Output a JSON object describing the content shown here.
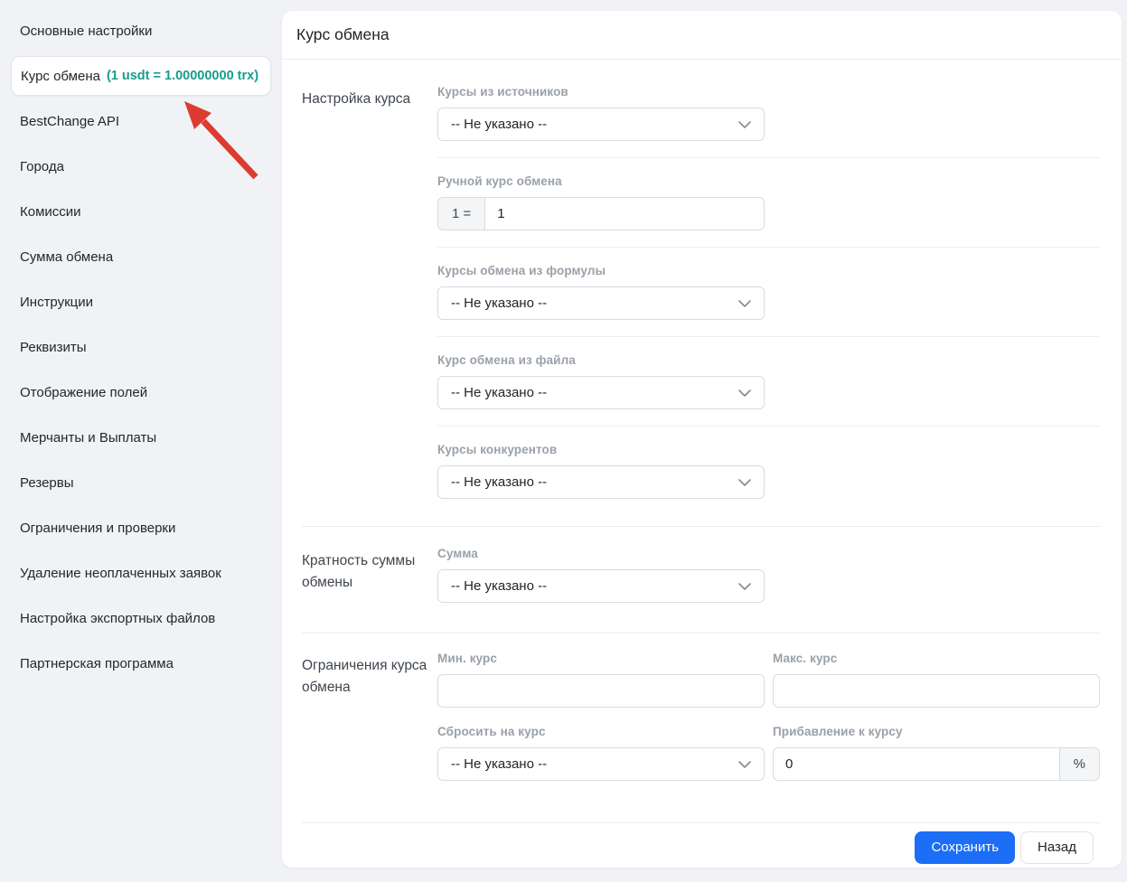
{
  "colors": {
    "page_background": "#f0f2f5",
    "accent_blue": "#1b6ef5",
    "rate_teal": "#1a9c8c",
    "annotation_red": "#dc3b2f"
  },
  "sidebar": {
    "items": [
      {
        "label": "Основные настройки"
      },
      {
        "label": "Курс обмена",
        "rate": "(1 usdt = 1.00000000 trx)",
        "active": true
      },
      {
        "label": "BestChange API"
      },
      {
        "label": "Города"
      },
      {
        "label": "Комиссии"
      },
      {
        "label": "Сумма обмена"
      },
      {
        "label": "Инструкции"
      },
      {
        "label": "Реквизиты"
      },
      {
        "label": "Отображение полей"
      },
      {
        "label": "Мерчанты и Выплаты"
      },
      {
        "label": "Резервы"
      },
      {
        "label": "Ограничения и проверки"
      },
      {
        "label": "Удаление неоплаченных заявок"
      },
      {
        "label": "Настройка экспортных файлов"
      },
      {
        "label": "Партнерская программа"
      }
    ]
  },
  "main": {
    "title": "Курс обмена",
    "sections": [
      {
        "label": "Настройка курса",
        "fields": [
          {
            "label": "Курсы из источников",
            "type": "select",
            "value": "-- Не указано --"
          },
          {
            "label": "Ручной курс обмена",
            "type": "rate-group",
            "prefix": "1 =",
            "value": "1"
          },
          {
            "label": "Курсы обмена из формулы",
            "type": "select",
            "value": "-- Не указано --"
          },
          {
            "label": "Курс обмена из файла",
            "type": "select",
            "value": "-- Не указано --"
          },
          {
            "label": "Курсы конкурентов",
            "type": "select",
            "value": "-- Не указано --"
          }
        ]
      },
      {
        "label": "Кратность суммы обмены",
        "fields": [
          {
            "label": "Сумма",
            "type": "select",
            "value": "-- Не указано --"
          }
        ]
      },
      {
        "label": "Ограничения курса обмена",
        "fields": [
          {
            "label": "Мин. курс",
            "type": "input",
            "value": ""
          },
          {
            "label": "Макс. курс",
            "type": "input",
            "value": ""
          },
          {
            "label": "Сбросить на курс",
            "type": "select",
            "value": "-- Не указано --"
          },
          {
            "label": "Прибавление к курсу",
            "type": "input-suffix",
            "value": "0",
            "suffix": "%"
          }
        ]
      }
    ],
    "footer": {
      "save_label": "Сохранить",
      "back_label": "Назад"
    }
  }
}
